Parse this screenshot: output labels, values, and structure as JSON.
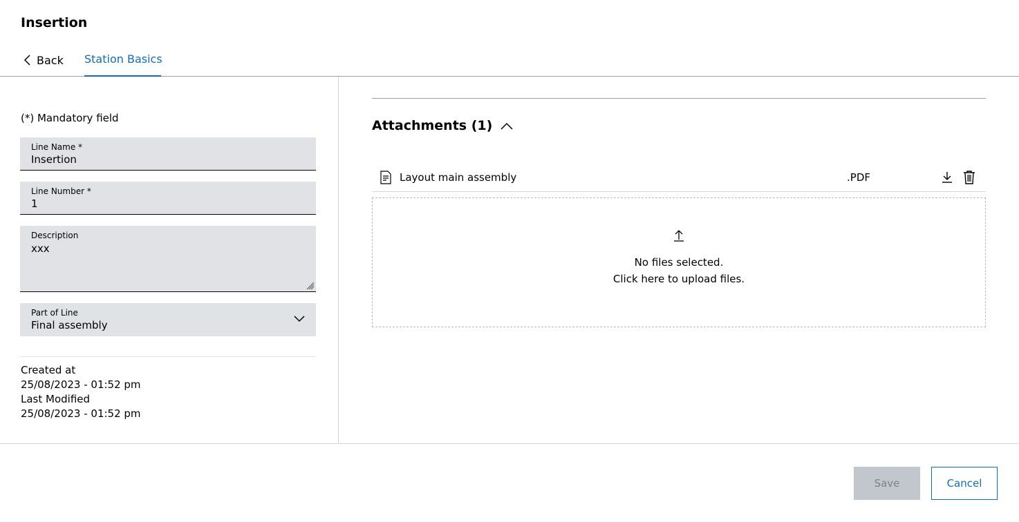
{
  "header": {
    "title": "Insertion"
  },
  "tabs": {
    "back_label": "Back",
    "active_label": "Station Basics"
  },
  "form": {
    "mandatory_note": "(*) Mandatory field",
    "line_name": {
      "label": "Line Name *",
      "value": "Insertion"
    },
    "line_number": {
      "label": "Line Number *",
      "value": "1"
    },
    "description": {
      "label": "Description",
      "value": "xxx"
    },
    "part_of_line": {
      "label": "Part of Line",
      "value": "Final assembly"
    }
  },
  "meta": {
    "created_label": "Created at",
    "created_value": "25/08/2023 - 01:52 pm",
    "modified_label": "Last Modified",
    "modified_value": "25/08/2023 - 01:52 pm"
  },
  "attachments": {
    "title": "Attachments (1)",
    "files": [
      {
        "name": "Layout main assembly",
        "type": ".PDF"
      }
    ],
    "dropzone_line1": "No files selected.",
    "dropzone_line2": "Click here to upload files."
  },
  "footer": {
    "save_label": "Save",
    "cancel_label": "Cancel"
  },
  "colors": {
    "accent": "#0f6eb4",
    "field_bg": "#e1e2e6",
    "disabled_bg": "#c1c7cc"
  }
}
